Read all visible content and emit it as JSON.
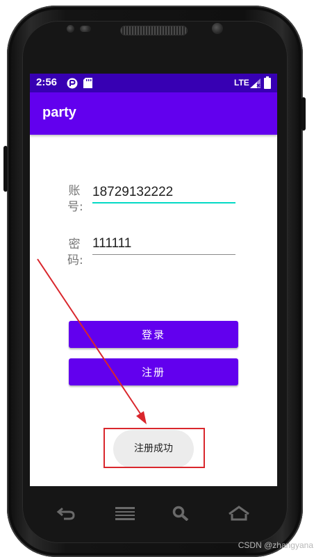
{
  "status_bar": {
    "time": "2:56",
    "network": "LTE",
    "icons": [
      "notification-app-icon",
      "sd-card-icon",
      "signal-icon",
      "battery-icon"
    ]
  },
  "app_bar": {
    "title": "party"
  },
  "login_form": {
    "account_label": "账号:",
    "account_value": "18729132222",
    "password_label": "密码:",
    "password_value": "111111",
    "login_button": "登录",
    "register_button": "注册"
  },
  "toast": {
    "message": "注册成功"
  },
  "device_nav": {
    "keys": [
      "back-icon",
      "menu-icon",
      "search-icon",
      "home-icon"
    ]
  },
  "watermark": {
    "text": "CSDN @zhangyana"
  },
  "colors": {
    "status_bar": "#3700b3",
    "primary": "#6200ee",
    "accent_underline": "#03dac5",
    "annotation_red": "#d9262c"
  }
}
